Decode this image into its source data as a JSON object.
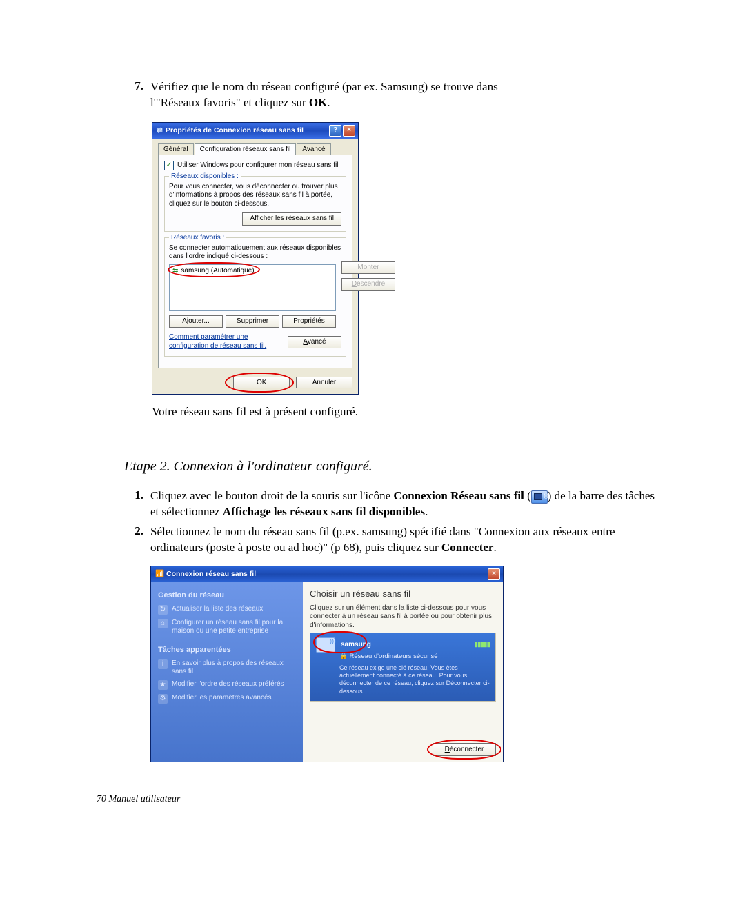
{
  "intro": {
    "num7": "7.",
    "line1a": "Vérifiez que le nom du réseau configuré (par ex. Samsung) se trouve dans",
    "line1b": "l'\"Réseaux favoris\"  et cliquez sur ",
    "ok_bold": "OK",
    "period": "."
  },
  "after_shot1": "Votre réseau sans fil est à présent configuré.",
  "step2_heading": "Etape 2. Connexion à l'ordinateur configuré.",
  "item1": {
    "num": "1.",
    "t1": "Cliquez avec le bouton droit de la souris sur l'icône ",
    "b1": "Connexion Réseau sans fil",
    "t2": " (",
    "t3": ") de la barre des tâches et sélectionnez ",
    "b2": "Affichage les réseaux sans fil disponibles",
    "t4": "."
  },
  "item2": {
    "num": "2.",
    "t1": "Sélectionnez le nom du réseau sans fil (p.ex. samsung) spécifié dans  \"Connexion aux réseaux entre ordinateurs (poste à poste ou ad hoc)\" (p 68), puis cliquez sur ",
    "b1": "Connecter",
    "t2": "."
  },
  "dlg1": {
    "title": "Propriétés de Connexion réseau sans fil",
    "help": "?",
    "close": "×",
    "tabs": {
      "general": "Général",
      "config": "Configuration réseaux sans fil",
      "adv": "Avancé"
    },
    "chk_label": "Utiliser Windows pour configurer mon réseau sans fil",
    "grp_available_title": "Réseaux disponibles :",
    "grp_available_text": "Pour vous connecter, vous déconnecter ou trouver plus d'informations à propos des réseaux sans fil à portée, cliquez sur le bouton ci-dessous.",
    "btn_view": "Afficher les réseaux sans fil",
    "grp_fav_title": "Réseaux favoris :",
    "grp_fav_text": "Se connecter automatiquement aux réseaux disponibles dans l'ordre indiqué ci-dessous :",
    "fav_item": "samsung (Automatique)",
    "btn_up": "Monter",
    "btn_down": "Descendre",
    "btn_add": "Ajouter...",
    "btn_del": "Supprimer",
    "btn_prop": "Propriétés",
    "howto_link": "Comment paramétrer une configuration de réseau sans fil.",
    "btn_adv2": "Avancé",
    "btn_ok": "OK",
    "btn_cancel": "Annuler"
  },
  "win2": {
    "title": "Connexion réseau sans fil",
    "close": "×",
    "side_h1": "Gestion du réseau",
    "side_l1": "Actualiser la liste des réseaux",
    "side_l2": "Configurer un réseau sans fil pour la maison ou une petite entreprise",
    "side_h2": "Tâches apparentées",
    "side_l3": "En savoir plus à propos des réseaux sans fil",
    "side_l4": "Modifier l'ordre des réseaux préférés",
    "side_l5": "Modifier les paramètres avancés",
    "main_h": "Choisir un réseau sans fil",
    "main_help": "Cliquez sur un élément dans la liste ci-dessous pour vous connecter à un réseau sans fil à portée ou pour obtenir plus d'informations.",
    "net_name": "samsung",
    "net_sub": "Réseau d'ordinateurs sécurisé",
    "net_desc": "Ce réseau exige une clé réseau. Vous êtes actuellement connecté à ce réseau. Pour vous déconnecter de ce réseau, cliquez sur Déconnecter ci-dessous.",
    "btn_disc": "Déconnecter"
  },
  "footer": "70  Manuel utilisateur"
}
